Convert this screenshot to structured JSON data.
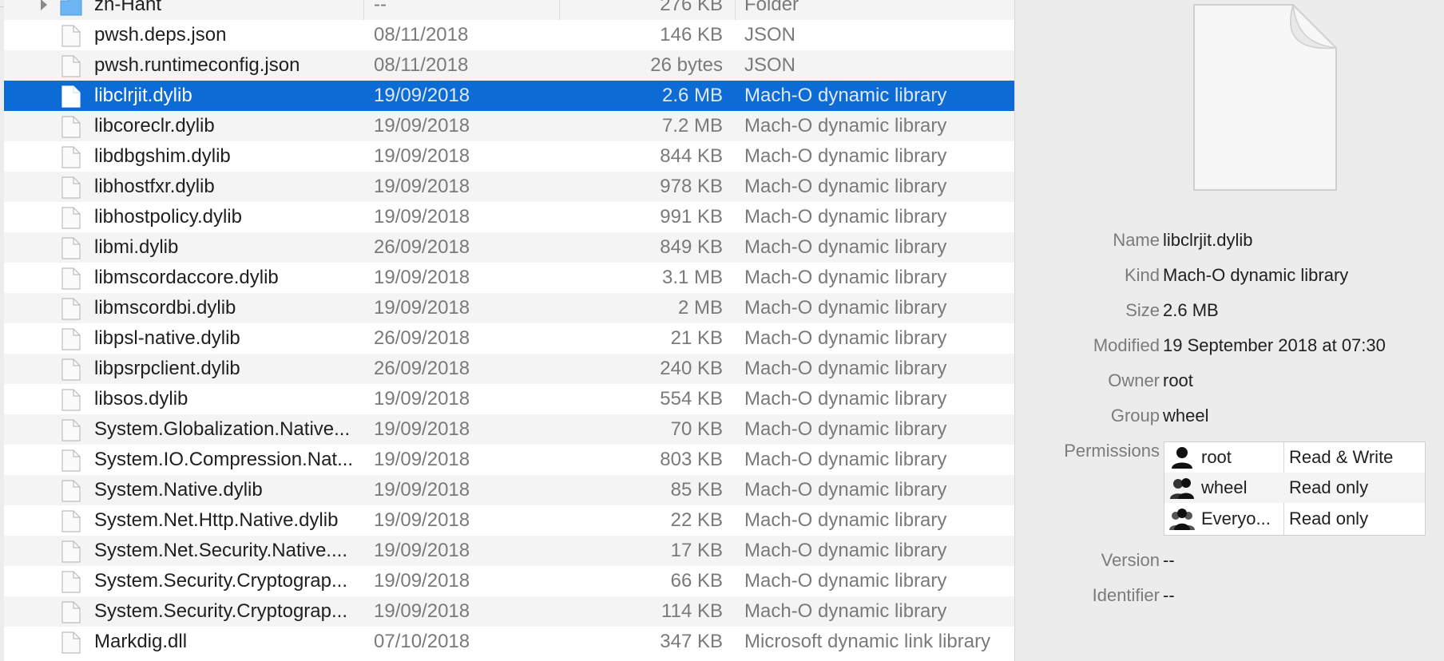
{
  "files": [
    {
      "name": "zh-Hant",
      "date": "--",
      "size": "276 KB",
      "kind": "Folder",
      "is_folder": true
    },
    {
      "name": "pwsh.deps.json",
      "date": "08/11/2018",
      "size": "146 KB",
      "kind": "JSON"
    },
    {
      "name": "pwsh.runtimeconfig.json",
      "date": "08/11/2018",
      "size": "26 bytes",
      "kind": "JSON"
    },
    {
      "name": "libclrjit.dylib",
      "date": "19/09/2018",
      "size": "2.6 MB",
      "kind": "Mach-O dynamic library",
      "selected": true
    },
    {
      "name": "libcoreclr.dylib",
      "date": "19/09/2018",
      "size": "7.2 MB",
      "kind": "Mach-O dynamic library"
    },
    {
      "name": "libdbgshim.dylib",
      "date": "19/09/2018",
      "size": "844 KB",
      "kind": "Mach-O dynamic library"
    },
    {
      "name": "libhostfxr.dylib",
      "date": "19/09/2018",
      "size": "978 KB",
      "kind": "Mach-O dynamic library"
    },
    {
      "name": "libhostpolicy.dylib",
      "date": "19/09/2018",
      "size": "991 KB",
      "kind": "Mach-O dynamic library"
    },
    {
      "name": "libmi.dylib",
      "date": "26/09/2018",
      "size": "849 KB",
      "kind": "Mach-O dynamic library"
    },
    {
      "name": "libmscordaccore.dylib",
      "date": "19/09/2018",
      "size": "3.1 MB",
      "kind": "Mach-O dynamic library"
    },
    {
      "name": "libmscordbi.dylib",
      "date": "19/09/2018",
      "size": "2 MB",
      "kind": "Mach-O dynamic library"
    },
    {
      "name": "libpsl-native.dylib",
      "date": "26/09/2018",
      "size": "21 KB",
      "kind": "Mach-O dynamic library"
    },
    {
      "name": "libpsrpclient.dylib",
      "date": "26/09/2018",
      "size": "240 KB",
      "kind": "Mach-O dynamic library"
    },
    {
      "name": "libsos.dylib",
      "date": "19/09/2018",
      "size": "554 KB",
      "kind": "Mach-O dynamic library"
    },
    {
      "name": "System.Globalization.Native...",
      "date": "19/09/2018",
      "size": "70 KB",
      "kind": "Mach-O dynamic library"
    },
    {
      "name": "System.IO.Compression.Nat...",
      "date": "19/09/2018",
      "size": "803 KB",
      "kind": "Mach-O dynamic library"
    },
    {
      "name": "System.Native.dylib",
      "date": "19/09/2018",
      "size": "85 KB",
      "kind": "Mach-O dynamic library"
    },
    {
      "name": "System.Net.Http.Native.dylib",
      "date": "19/09/2018",
      "size": "22 KB",
      "kind": "Mach-O dynamic library"
    },
    {
      "name": "System.Net.Security.Native....",
      "date": "19/09/2018",
      "size": "17 KB",
      "kind": "Mach-O dynamic library"
    },
    {
      "name": "System.Security.Cryptograp...",
      "date": "19/09/2018",
      "size": "66 KB",
      "kind": "Mach-O dynamic library"
    },
    {
      "name": "System.Security.Cryptograp...",
      "date": "19/09/2018",
      "size": "114 KB",
      "kind": "Mach-O dynamic library"
    },
    {
      "name": "Markdig.dll",
      "date": "07/10/2018",
      "size": "347 KB",
      "kind": "Microsoft dynamic link library"
    }
  ],
  "info": {
    "name_label": "Name",
    "name": "libclrjit.dylib",
    "kind_label": "Kind",
    "kind": "Mach-O dynamic library",
    "size_label": "Size",
    "size": "2.6 MB",
    "modified_label": "Modified",
    "modified": "19 September 2018 at 07:30",
    "owner_label": "Owner",
    "owner": "root",
    "group_label": "Group",
    "group": "wheel",
    "permissions_label": "Permissions",
    "version_label": "Version",
    "version": "--",
    "identifier_label": "Identifier",
    "identifier": "--"
  },
  "permissions": [
    {
      "name": "root",
      "access": "Read & Write",
      "icon": "single-user-icon"
    },
    {
      "name": "wheel",
      "access": "Read only",
      "icon": "group-icon"
    },
    {
      "name": "Everyo...",
      "access": "Read only",
      "icon": "everyone-icon"
    }
  ],
  "colors": {
    "selection": "#0d6bd6",
    "panel_bg": "#ececec",
    "alt_row": "#f4f4f4"
  }
}
